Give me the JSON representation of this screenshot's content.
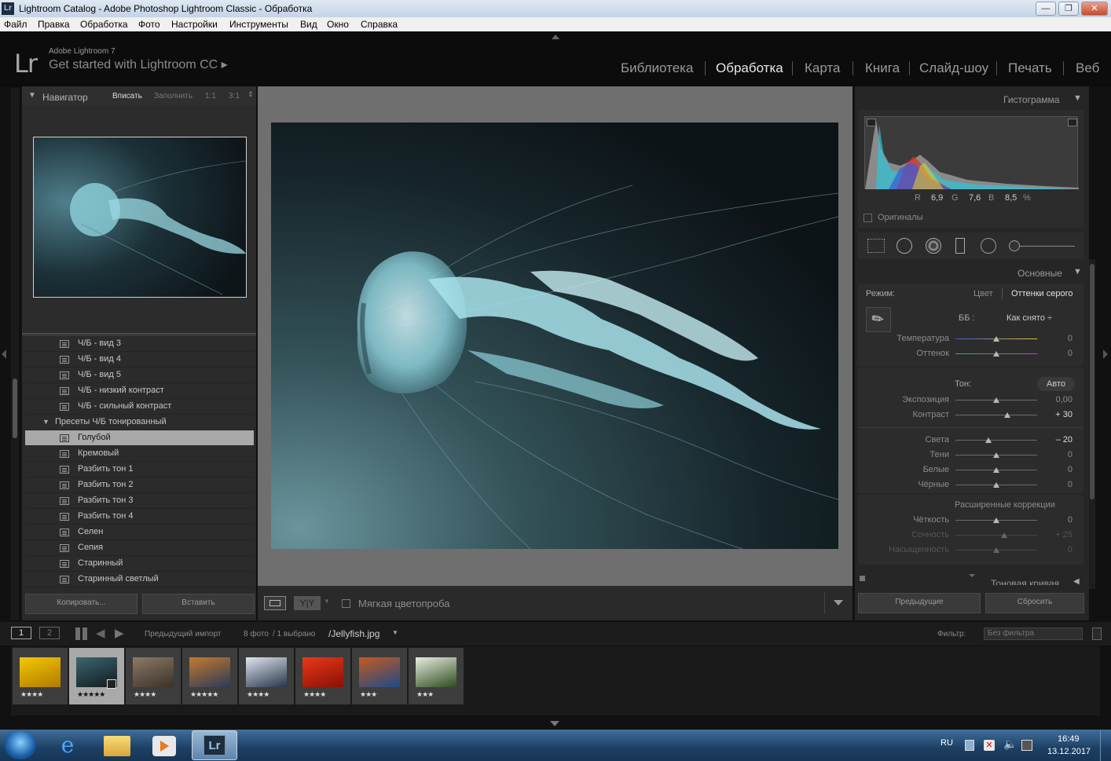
{
  "window": {
    "icon_text": "Lr",
    "title": "Lightroom Catalog - Adobe Photoshop Lightroom Classic - Обработка",
    "btn_min": "—",
    "btn_max": "❐",
    "btn_close": "✕"
  },
  "menu": [
    "Файл",
    "Правка",
    "Обработка",
    "Фото",
    "Настройки",
    "Инструменты",
    "Вид",
    "Окно",
    "Справка"
  ],
  "identity": {
    "logo": "Lr",
    "version": "Adobe Lightroom 7",
    "promo": "Get started with Lightroom CC ▸"
  },
  "modules": [
    "Библиотека",
    "Обработка",
    "Карта",
    "Книга",
    "Слайд-шоу",
    "Печать",
    "Веб"
  ],
  "active_module": "Обработка",
  "navigator": {
    "title": "Навигатор",
    "zoom": [
      "Вписать",
      "Заполнить",
      "1:1",
      "3:1"
    ],
    "active_zoom": "Вписать"
  },
  "presets": [
    {
      "label": "Ч/Б - вид 3",
      "type": "preset"
    },
    {
      "label": "Ч/Б - вид 4",
      "type": "preset"
    },
    {
      "label": "Ч/Б - вид 5",
      "type": "preset"
    },
    {
      "label": "Ч/Б - низкий контраст",
      "type": "preset"
    },
    {
      "label": "Ч/Б - сильный контраст",
      "type": "preset"
    },
    {
      "label": "Пресеты Ч/Б тонированный",
      "type": "folder"
    },
    {
      "label": "Голубой",
      "type": "preset",
      "selected": true
    },
    {
      "label": "Кремовый",
      "type": "preset"
    },
    {
      "label": "Разбить тон 1",
      "type": "preset"
    },
    {
      "label": "Разбить тон 2",
      "type": "preset"
    },
    {
      "label": "Разбить тон 3",
      "type": "preset"
    },
    {
      "label": "Разбить тон 4",
      "type": "preset"
    },
    {
      "label": "Селен",
      "type": "preset"
    },
    {
      "label": "Сепия",
      "type": "preset"
    },
    {
      "label": "Старинный",
      "type": "preset"
    },
    {
      "label": "Старинный светлый",
      "type": "preset"
    }
  ],
  "left_buttons": {
    "copy": "Копировать...",
    "paste": "Вставить"
  },
  "toolbar": {
    "soft_proof": "Мягкая цветопроба"
  },
  "histogram": {
    "title": "Гистограмма",
    "r_label": "R",
    "r": "6,9",
    "g_label": "G",
    "g": "7,6",
    "b_label": "B",
    "b": "8,5",
    "pct": "%",
    "originals": "Оригиналы"
  },
  "basic": {
    "title": "Основные",
    "mode_label": "Режим:",
    "mode_color": "Цвет",
    "mode_gray": "Оттенки серого",
    "wb_label": "ББ :",
    "wb_value": "Как снято ÷",
    "temp": {
      "label": "Температура",
      "value": "0",
      "pos": 0.5
    },
    "tint": {
      "label": "Оттенок",
      "value": "0",
      "pos": 0.5
    },
    "tone_label": "Тон:",
    "auto": "Авто",
    "exposure": {
      "label": "Экспозиция",
      "value": "0,00",
      "pos": 0.5
    },
    "contrast": {
      "label": "Контраст",
      "value": "+ 30",
      "pos": 0.63
    },
    "highlights": {
      "label": "Света",
      "value": "– 20",
      "pos": 0.4
    },
    "shadows": {
      "label": "Тени",
      "value": "0",
      "pos": 0.5
    },
    "whites": {
      "label": "Белые",
      "value": "0",
      "pos": 0.5
    },
    "blacks": {
      "label": "Чёрные",
      "value": "0",
      "pos": 0.5
    },
    "presence_label": "Расширенные коррекции",
    "clarity": {
      "label": "Чёткость",
      "value": "0",
      "pos": 0.5
    },
    "vibrance": {
      "label": "Сочность",
      "value": "+ 25",
      "pos": 0.6
    },
    "saturation": {
      "label": "Насыщенность",
      "value": "0",
      "pos": 0.5
    }
  },
  "tone_curve": "Тоновая кривая",
  "right_buttons": {
    "previous": "Предыдущие",
    "reset": "Сбросить"
  },
  "filmbar": {
    "view1": "1",
    "view2": "2",
    "source": "Предыдущий импорт",
    "count": "8 фото",
    "selected": "/ 1 выбрано",
    "file": "/Jellyfish.jpg",
    "filter_label": "Фильтр:",
    "filter_value": "Без фильтра"
  },
  "filmstrip": [
    {
      "stars": "★★★★",
      "colors": [
        "#f5c800",
        "#b07a00"
      ]
    },
    {
      "stars": "★★★★★",
      "colors": [
        "#3f6670",
        "#0f1a1e"
      ],
      "selected": true
    },
    {
      "stars": "★★★★",
      "colors": [
        "#8c7a66",
        "#3a3229"
      ]
    },
    {
      "stars": "★★★★★",
      "colors": [
        "#c47a2e",
        "#2a3a5a"
      ]
    },
    {
      "stars": "★★★★",
      "colors": [
        "#dfe6ee",
        "#28344a"
      ]
    },
    {
      "stars": "★★★★",
      "colors": [
        "#e8391a",
        "#8a1005"
      ]
    },
    {
      "stars": "★★★",
      "colors": [
        "#c65a20",
        "#1e4a86"
      ]
    },
    {
      "stars": "★★★",
      "colors": [
        "#e8eee0",
        "#2d4a1e"
      ]
    }
  ],
  "taskbar": {
    "lang": "RU",
    "time": "16:49",
    "date": "13.12.2017"
  }
}
